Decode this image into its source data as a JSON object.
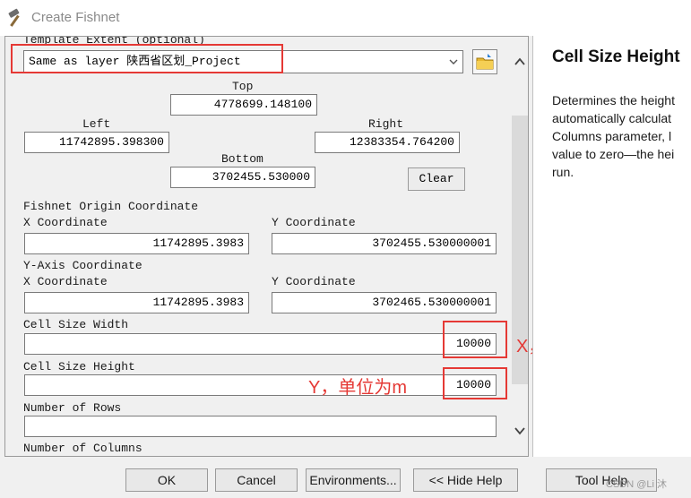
{
  "window": {
    "title": "Create Fishnet",
    "icon": "hammer-icon"
  },
  "form": {
    "template_extent_label": "Template Extent (optional)",
    "template_extent_value": "Same as layer 陕西省区划_Project",
    "top_label": "Top",
    "top_value": "4778699.148100",
    "left_label": "Left",
    "left_value": "11742895.398300",
    "right_label": "Right",
    "right_value": "12383354.764200",
    "bottom_label": "Bottom",
    "bottom_value": "3702455.530000",
    "clear_label": "Clear",
    "origin_label": "Fishnet Origin Coordinate",
    "origin_x_label": "X Coordinate",
    "origin_x_value": "11742895.3983",
    "origin_y_label": "Y Coordinate",
    "origin_y_value": "3702455.530000001",
    "yaxis_label": "Y-Axis Coordinate",
    "yaxis_x_label": "X Coordinate",
    "yaxis_x_value": "11742895.3983",
    "yaxis_y_label": "Y Coordinate",
    "yaxis_y_value": "3702465.530000001",
    "cell_width_label": "Cell Size Width",
    "cell_width_value": "10000",
    "cell_height_label": "Cell Size Height",
    "cell_height_value": "10000",
    "rows_label": "Number of Rows",
    "rows_value": "",
    "columns_label": "Number of Columns"
  },
  "annotations": {
    "width_note": "X，单位为m",
    "height_note": "Y，单位为m",
    "color": "#e53935"
  },
  "help": {
    "title": "Cell Size Height",
    "lines": [
      "Determines the height",
      "automatically calculat",
      "Columns parameter, l",
      "value to zero—the hei",
      "run."
    ]
  },
  "buttons": {
    "ok": "OK",
    "cancel": "Cancel",
    "environments": "Environments...",
    "hide_help": "<< Hide Help",
    "tool_help": "Tool Help"
  },
  "watermark": "CSDN @Li 沐"
}
